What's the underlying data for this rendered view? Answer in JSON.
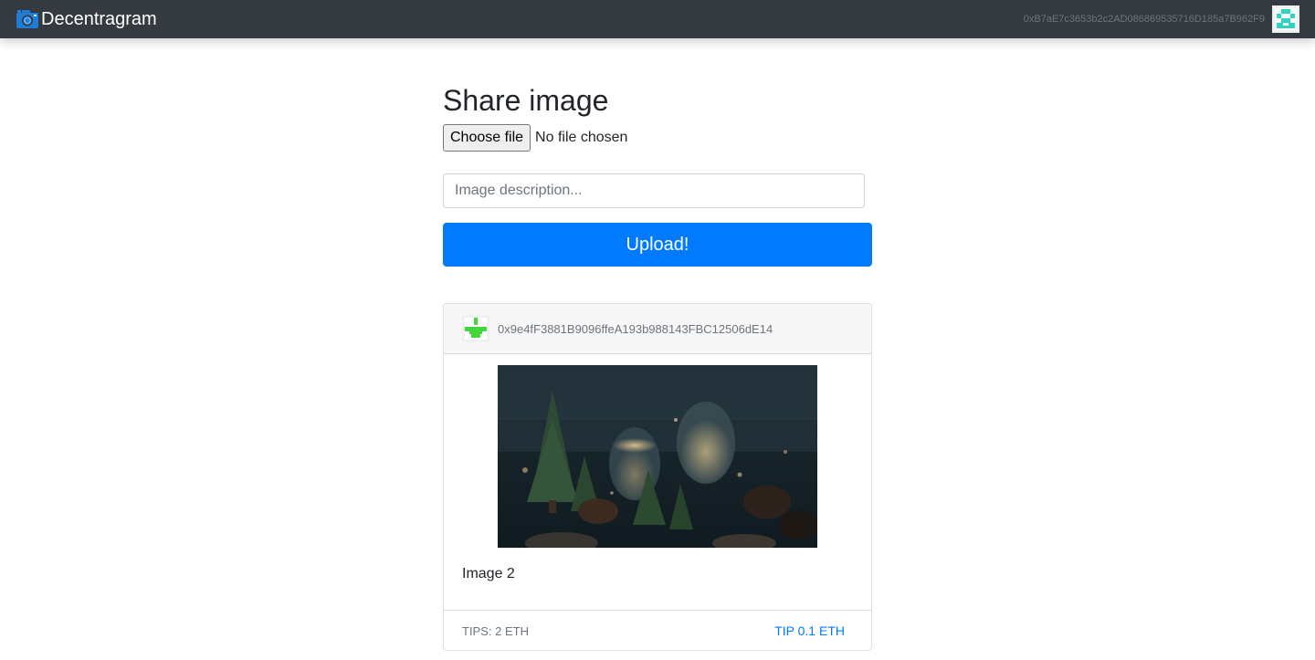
{
  "navbar": {
    "brand": "Decentragram",
    "brand_icon": "camera-icon",
    "account": "0xB7aE7c3653b2c2AD086869535716D185a7B962F9",
    "account_avatar": "identicon-avatar"
  },
  "upload_form": {
    "title": "Share image",
    "file_button": "Choose file",
    "file_status": "No file chosen",
    "description_placeholder": "Image description...",
    "upload_button": "Upload!"
  },
  "posts": [
    {
      "author": "0x9e4fF3881B9096ffeA193b988143FBC12506dE14",
      "author_avatar": "identicon-avatar",
      "image": "christmas-candles-photo",
      "description": "Image 2",
      "tips": "TIPS: 2 ETH",
      "tip_action": "TIP 0.1 ETH"
    }
  ],
  "colors": {
    "navbar_bg": "#343a40",
    "primary": "#007bff",
    "muted": "#6c757d",
    "account_identicon": "#2ed4c4",
    "author_identicon": "#44d63a"
  }
}
